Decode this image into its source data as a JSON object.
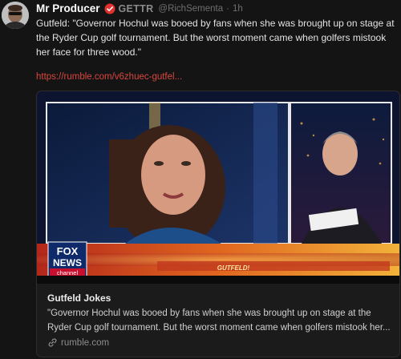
{
  "post": {
    "author_name": "Mr Producer",
    "platform_label": "GETTR",
    "handle": "@RichSementa",
    "separator": "·",
    "time_ago": "1h",
    "text": "Gutfeld: \"Governor Hochul was booed by fans when she was brought up on stage at the Ryder Cup golf tournament. But the worst moment came when golfers mistook her face for three wood.\"",
    "link": "https://rumble.com/v6zhuec-gutfel..."
  },
  "card": {
    "title": "Gutfeld Jokes",
    "description": "\"Governor Hochul was booed by fans when she was brought up on stage at the Ryder Cup golf tournament. But the worst moment came when golfers mistook her...",
    "domain": "rumble.com",
    "thumbnail": {
      "network_logo_line1": "FOX",
      "network_logo_line2": "NEWS",
      "network_logo_line3": "channel",
      "show_label": "GUTFELD!"
    }
  },
  "colors": {
    "background": "#141414",
    "link": "#d9463f",
    "verified_badge": "#e0322f",
    "ticker": "#e0661f"
  },
  "icons": {
    "verified": "verified-badge-icon",
    "domain_link": "link-icon"
  }
}
